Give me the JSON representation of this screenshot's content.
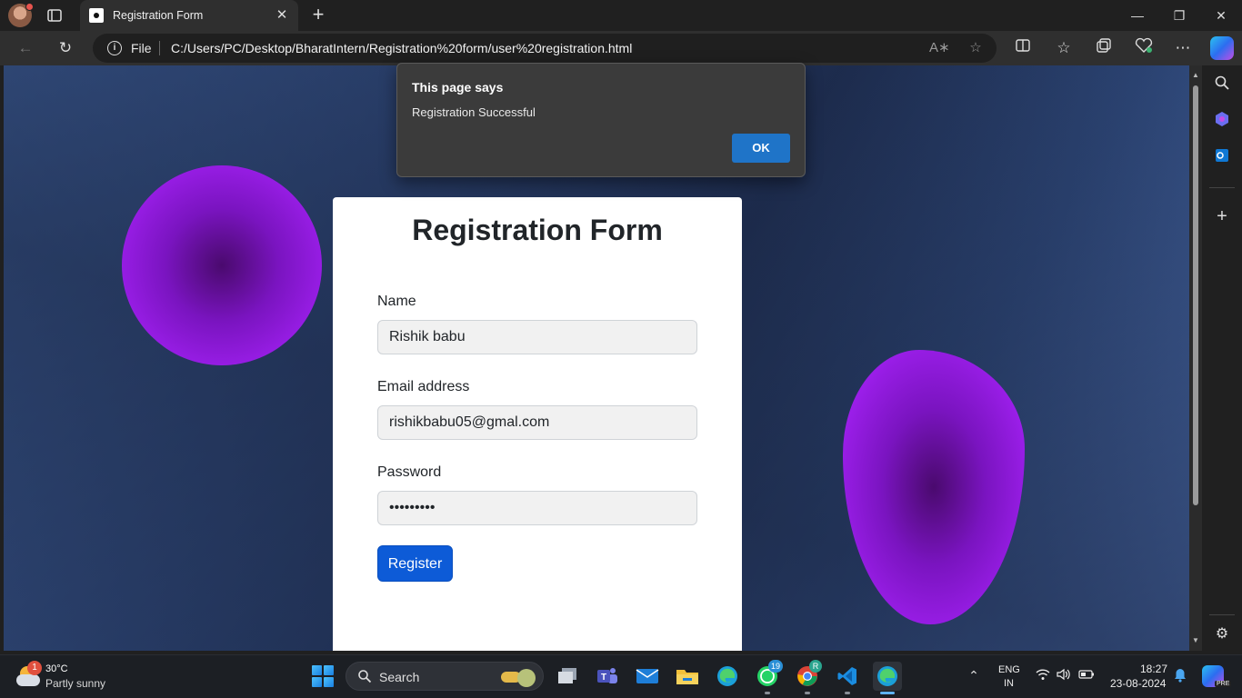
{
  "browser": {
    "tab_title": "Registration Form",
    "tab_close": "✕",
    "new_tab": "+",
    "window_controls": {
      "minimize": "—",
      "restore": "❐",
      "close": "✕"
    },
    "address": {
      "scheme_label": "File",
      "url": "C:/Users/PC/Desktop/BharatIntern/Registration%20form/user%20registration.html"
    },
    "icons": [
      "back-icon",
      "refresh-icon",
      "info-icon",
      "read-aloud-icon",
      "favorite-star-icon",
      "split-screen-icon",
      "favorites-icon",
      "collections-icon",
      "browser-essentials-icon",
      "more-icon",
      "copilot-icon"
    ]
  },
  "dialog": {
    "title": "This page says",
    "message": "Registration Successful",
    "ok_label": "OK"
  },
  "form": {
    "title": "Registration Form",
    "fields": [
      {
        "label": "Name",
        "value": "Rishik babu"
      },
      {
        "label": "Email address",
        "value": "rishikbabu05@gmal.com"
      },
      {
        "label": "Password",
        "value": "•••••••••"
      }
    ],
    "submit_label": "Register"
  },
  "sidebar": {
    "icons": [
      "search-icon",
      "copilot-icon",
      "outlook-icon",
      "add-icon",
      "settings-icon"
    ]
  },
  "taskbar": {
    "weather": {
      "badge": "1",
      "temp": "30°C",
      "condition": "Partly sunny"
    },
    "search_label": "Search",
    "apps": [
      {
        "name": "file-explorer-sidebar",
        "badge": ""
      },
      {
        "name": "teams",
        "badge": ""
      },
      {
        "name": "mail",
        "badge": ""
      },
      {
        "name": "file-explorer",
        "badge": ""
      },
      {
        "name": "edge",
        "badge": ""
      },
      {
        "name": "whatsapp",
        "badge": "19"
      },
      {
        "name": "chrome",
        "badge": "R"
      },
      {
        "name": "vscode",
        "badge": ""
      },
      {
        "name": "edge-active",
        "badge": ""
      }
    ],
    "language": {
      "line1": "ENG",
      "line2": "IN"
    },
    "clock": {
      "time": "18:27",
      "date": "23-08-2024"
    },
    "copilot_tag": "PRE"
  },
  "colors": {
    "primary_button": "#0d5bd7",
    "dialog_ok": "#1f74c8",
    "blob": "#9a1ee8"
  }
}
